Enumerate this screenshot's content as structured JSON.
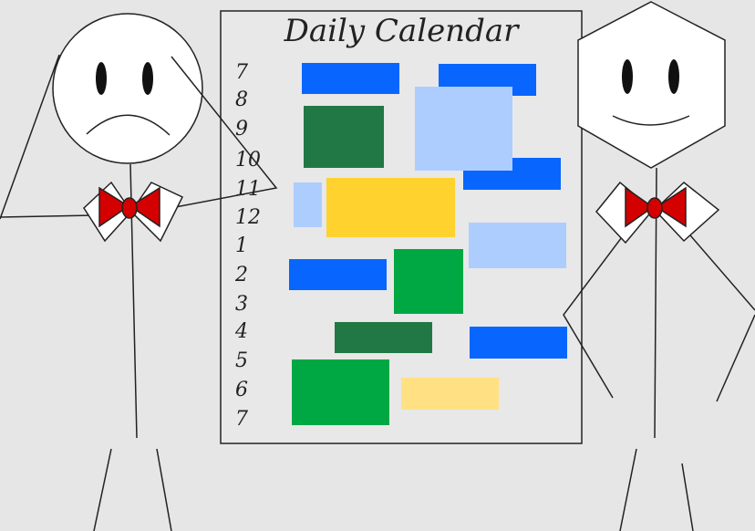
{
  "board": {
    "title": "Daily Calendar",
    "hours": [
      "7",
      "8",
      "9",
      "10",
      "11",
      "12",
      "1",
      "2",
      "3",
      "4",
      "5",
      "6",
      "7"
    ]
  },
  "colors": {
    "background": "#e6e6e6",
    "board": "#e8e8e8",
    "blue": "#0866ff",
    "light_blue": "#aecdff",
    "dark_green": "#217844",
    "green": "#00a844",
    "yellow": "#ffd22e",
    "light_yellow": "#ffe184",
    "bowtie": "#d40000"
  },
  "people": [
    {
      "name": "sad-stick-figure",
      "expression": "frown",
      "head": "circle"
    },
    {
      "name": "happy-stick-figure",
      "expression": "smile",
      "head": "hexagon"
    }
  ]
}
